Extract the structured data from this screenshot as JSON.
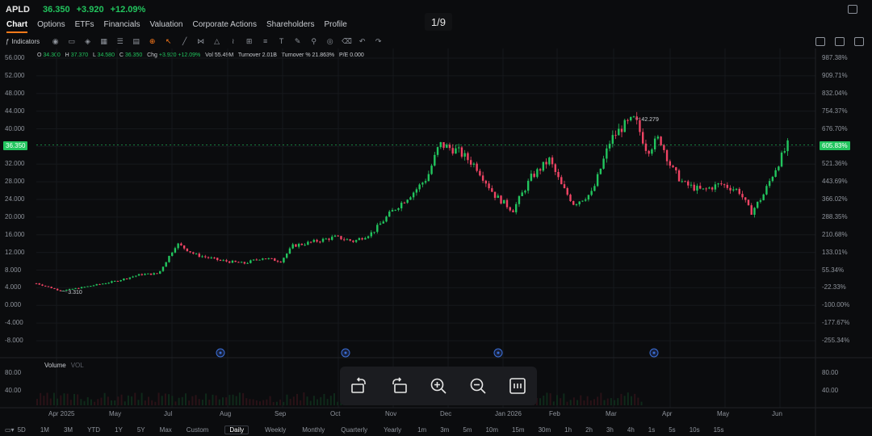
{
  "header": {
    "ticker": "APLD",
    "price": "36.350",
    "change": "+3.920",
    "change_pct": "+12.09%"
  },
  "pager": "1/9",
  "nav_tabs": [
    "Chart",
    "Options",
    "ETFs",
    "Financials",
    "Valuation",
    "Corporate Actions",
    "Shareholders",
    "Profile"
  ],
  "toolbar": {
    "indicators_label": "Indicators"
  },
  "ohlc": {
    "o_label": "O",
    "o": "34.300",
    "h_label": "H",
    "h": "37.370",
    "l_label": "L",
    "l": "34.580",
    "c_label": "C",
    "c": "36.350",
    "chg_label": "Chg",
    "chg": "+3.920",
    "chg_pct": "+12.09%",
    "vol_label": "Vol",
    "vol": "55.49M",
    "turnover_label": "Turnover",
    "turnover": "2.01B",
    "turnover_pct_label": "Turnover %",
    "turnover_pct": "21.863%",
    "pe_label": "P/E",
    "pe": "0.000"
  },
  "left_axis": [
    "56.000",
    "52.000",
    "48.000",
    "44.000",
    "40.000",
    "36.000",
    "32.000",
    "28.000",
    "24.000",
    "20.000",
    "16.000",
    "12.000",
    "8.000",
    "4.000",
    "0.000",
    "-4.000",
    "-8.000"
  ],
  "right_axis": [
    "987.38%",
    "909.71%",
    "832.04%",
    "754.37%",
    "676.70%",
    "",
    "521.36%",
    "443.69%",
    "366.02%",
    "288.35%",
    "210.68%",
    "133.01%",
    "55.34%",
    "-22.33%",
    "-100.00%",
    "-177.67%",
    "-255.34%"
  ],
  "current_price_tag": "36.350",
  "current_pct_tag": "605.83%",
  "annotations": {
    "high": "42.279",
    "low": "3.310"
  },
  "volume": {
    "label": "Volume",
    "sub": "VOL",
    "left_ticks": [
      "80.00",
      "40.00"
    ],
    "right_ticks": [
      "80.00",
      "40.00"
    ]
  },
  "x_axis": [
    "Apr 2025",
    "May",
    "Jul",
    "Aug",
    "Sep",
    "Oct",
    "Nov",
    "Dec",
    "Jan 2026",
    "Feb",
    "Mar",
    "Apr",
    "May",
    "Jun"
  ],
  "timeframes": [
    "5D",
    "1M",
    "3M",
    "YTD",
    "1Y",
    "5Y",
    "Max",
    "Custom",
    "Daily",
    "Weekly",
    "Monthly",
    "Quarterly",
    "Yearly",
    "1m",
    "3m",
    "5m",
    "10m",
    "15m",
    "30m",
    "1h",
    "2h",
    "3h",
    "4h",
    "1s",
    "5s",
    "10s",
    "15s"
  ],
  "selected_timeframe": "Daily",
  "colors": {
    "up": "#22c55e",
    "down": "#ef4464",
    "accent": "#ff7a1a",
    "bg": "#0b0c0e"
  },
  "chart_data": {
    "type": "candlestick",
    "ylim": [
      -8,
      56
    ],
    "x": [
      "Apr 2025",
      "May",
      "Jul",
      "Aug",
      "Sep",
      "Oct",
      "Nov",
      "Dec",
      "Jan 2026",
      "Feb",
      "Mar",
      "Apr"
    ],
    "close_path": [
      [
        0,
        5.0
      ],
      [
        0.04,
        3.3
      ],
      [
        0.08,
        4.2
      ],
      [
        0.13,
        5.5
      ],
      [
        0.17,
        7.0
      ],
      [
        0.2,
        7.2
      ],
      [
        0.23,
        14.0
      ],
      [
        0.26,
        11.5
      ],
      [
        0.3,
        10.2
      ],
      [
        0.34,
        9.5
      ],
      [
        0.37,
        10.8
      ],
      [
        0.4,
        10.0
      ],
      [
        0.42,
        13.5
      ],
      [
        0.45,
        14.3
      ],
      [
        0.49,
        15.5
      ],
      [
        0.52,
        14.5
      ],
      [
        0.55,
        16.5
      ],
      [
        0.58,
        21.0
      ],
      [
        0.62,
        26.0
      ],
      [
        0.64,
        29.0
      ],
      [
        0.66,
        36.5
      ],
      [
        0.69,
        35.0
      ],
      [
        0.72,
        31.5
      ],
      [
        0.75,
        25.0
      ],
      [
        0.78,
        21.5
      ],
      [
        0.81,
        29.0
      ],
      [
        0.84,
        33.0
      ],
      [
        0.86,
        27.0
      ],
      [
        0.88,
        23.0
      ],
      [
        0.91,
        25.5
      ],
      [
        0.94,
        37.5
      ],
      [
        0.96,
        40.5
      ],
      [
        0.98,
        42.2
      ],
      [
        1.0,
        35.0
      ],
      [
        1.02,
        38.0
      ],
      [
        1.04,
        31.0
      ],
      [
        1.06,
        27.5
      ],
      [
        1.09,
        26.0
      ],
      [
        1.12,
        27.5
      ],
      [
        1.15,
        26.0
      ],
      [
        1.17,
        21.0
      ],
      [
        1.19,
        25.0
      ],
      [
        1.21,
        31.0
      ],
      [
        1.23,
        36.3
      ]
    ]
  }
}
